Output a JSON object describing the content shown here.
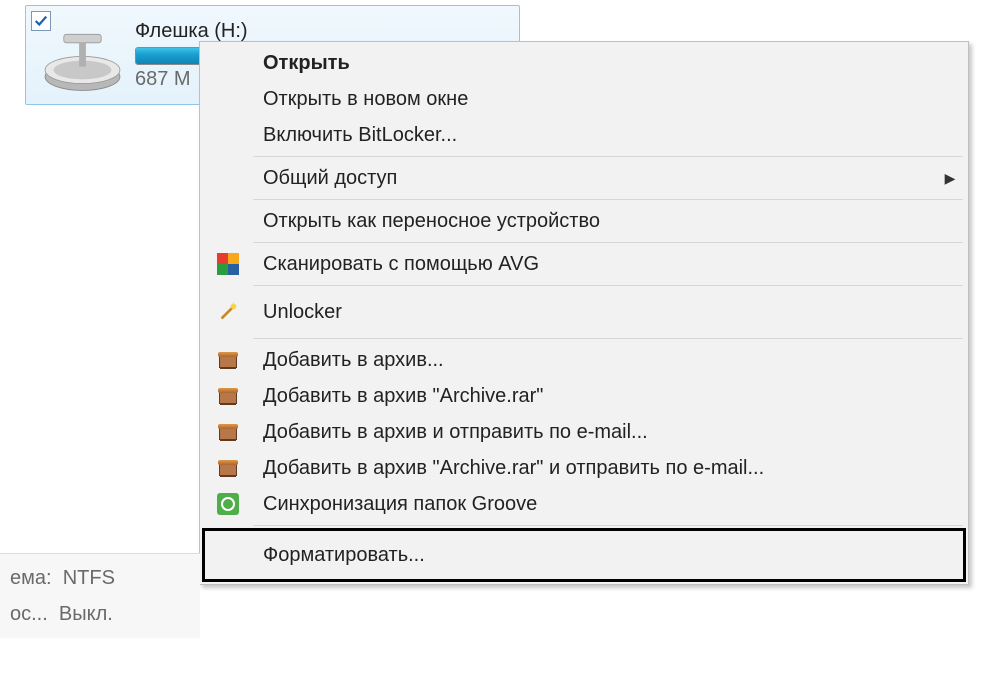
{
  "drive": {
    "name": "Флешка (H:)",
    "size_text": "687 M",
    "fill_percent": 52
  },
  "menu": {
    "open": "Открыть",
    "open_new_window": "Открыть в новом окне",
    "enable_bitlocker": "Включить BitLocker...",
    "share": "Общий доступ",
    "open_portable": "Открыть как переносное устройство",
    "scan_avg": "Сканировать с помощью AVG",
    "unlocker": "Unlocker",
    "add_to_archive": "Добавить в архив...",
    "add_to_archive_named": "Добавить в архив \"Archive.rar\"",
    "add_and_email": "Добавить в архив и отправить по e-mail...",
    "add_named_and_email": "Добавить в архив \"Archive.rar\" и отправить по e-mail...",
    "groove_sync": "Синхронизация папок Groove",
    "format": "Форматировать..."
  },
  "info": {
    "fs_label": "ема:",
    "fs_value": "NTFS",
    "compress_label": "ос...",
    "compress_value": "Выкл."
  }
}
